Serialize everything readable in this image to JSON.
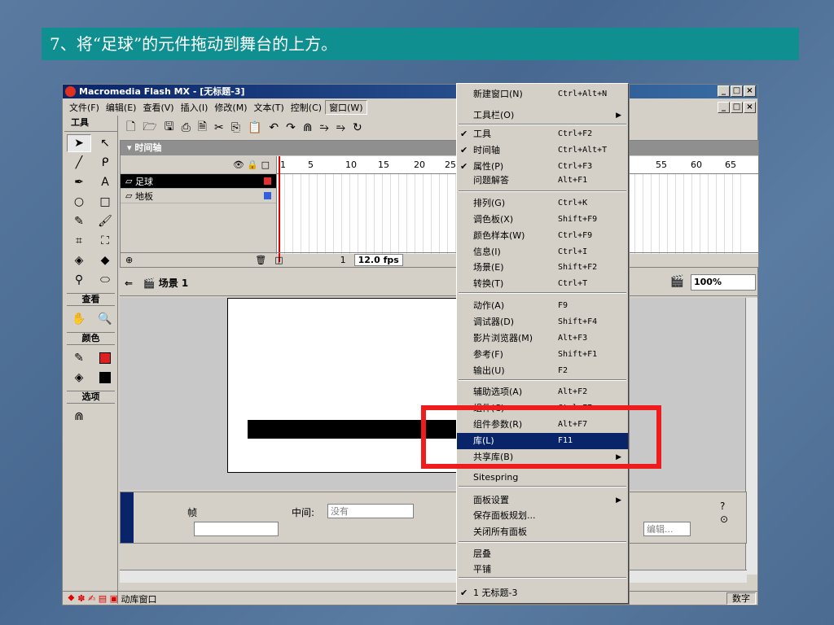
{
  "slide": {
    "title": "7、将“足球”的元件拖动到舞台的上方。"
  },
  "window": {
    "title": "Macromedia Flash MX - [无标题-3]",
    "min": "_",
    "max": "□",
    "close": "×"
  },
  "menubar": {
    "items": [
      "文件(F)",
      "编辑(E)",
      "查看(V)",
      "插入(I)",
      "修改(M)",
      "文本(T)",
      "控制(C)",
      "窗口(W)"
    ],
    "active_index": 7
  },
  "tools": {
    "header": "工具",
    "section_view": "查看",
    "section_colors": "颜色",
    "section_options": "选项",
    "stroke_color": "#e02020",
    "fill_color": "#000000"
  },
  "timeline": {
    "header": "时间轴",
    "layers": [
      {
        "name": "足球",
        "selected": true,
        "color": "#e03030"
      },
      {
        "name": "地板",
        "selected": false,
        "color": "#3060e0"
      }
    ],
    "ruler": [
      "1",
      "5",
      "10",
      "15",
      "20",
      "25",
      "55",
      "60",
      "65"
    ],
    "current_frame": "1",
    "fps": "12.0 fps"
  },
  "scene": {
    "label": "场景 1",
    "zoom": "100%"
  },
  "props": {
    "frame_label": "帧",
    "tween_label": "中间:",
    "tween_value": "没有",
    "edit_button": "编辑..."
  },
  "statusbar": {
    "text": "动库窗口",
    "num": "数字"
  },
  "window_menu": {
    "items": [
      {
        "label": "新建窗口(N)",
        "shortcut": "Ctrl+Alt+N"
      },
      {
        "label": "工具栏(O)",
        "submenu": true
      },
      {
        "label": "工具",
        "shortcut": "Ctrl+F2",
        "checked": true
      },
      {
        "label": "时间轴",
        "shortcut": "Ctrl+Alt+T",
        "checked": true
      },
      {
        "label": "属性(P)",
        "shortcut": "Ctrl+F3",
        "checked": true
      },
      {
        "label": "问题解答",
        "shortcut": "Alt+F1"
      },
      {
        "label": "排列(G)",
        "shortcut": "Ctrl+K"
      },
      {
        "label": "调色板(X)",
        "shortcut": "Shift+F9"
      },
      {
        "label": "颜色样本(W)",
        "shortcut": "Ctrl+F9"
      },
      {
        "label": "信息(I)",
        "shortcut": "Ctrl+I"
      },
      {
        "label": "场景(E)",
        "shortcut": "Shift+F2"
      },
      {
        "label": "转换(T)",
        "shortcut": "Ctrl+T"
      },
      {
        "label": "动作(A)",
        "shortcut": "F9"
      },
      {
        "label": "调试器(D)",
        "shortcut": "Shift+F4"
      },
      {
        "label": "影片浏览器(M)",
        "shortcut": "Alt+F3"
      },
      {
        "label": "参考(F)",
        "shortcut": "Shift+F1"
      },
      {
        "label": "输出(U)",
        "shortcut": "F2"
      },
      {
        "label": "辅助选项(A)",
        "shortcut": "Alt+F2"
      },
      {
        "label": "组件(C)",
        "shortcut": "Ctrl+F7"
      },
      {
        "label": "组件参数(R)",
        "shortcut": "Alt+F7"
      },
      {
        "label": "库(L)",
        "shortcut": "F11",
        "highlighted": true
      },
      {
        "label": "共享库(B)",
        "submenu": true
      },
      {
        "label": "Sitespring"
      },
      {
        "label": "面板设置",
        "submenu": true
      },
      {
        "label": "保存面板规划..."
      },
      {
        "label": "关闭所有面板"
      },
      {
        "label": "层叠"
      },
      {
        "label": "平铺"
      },
      {
        "label": "1 无标题-3",
        "checked": true
      }
    ]
  },
  "highlight_color": "#ee1c1c"
}
